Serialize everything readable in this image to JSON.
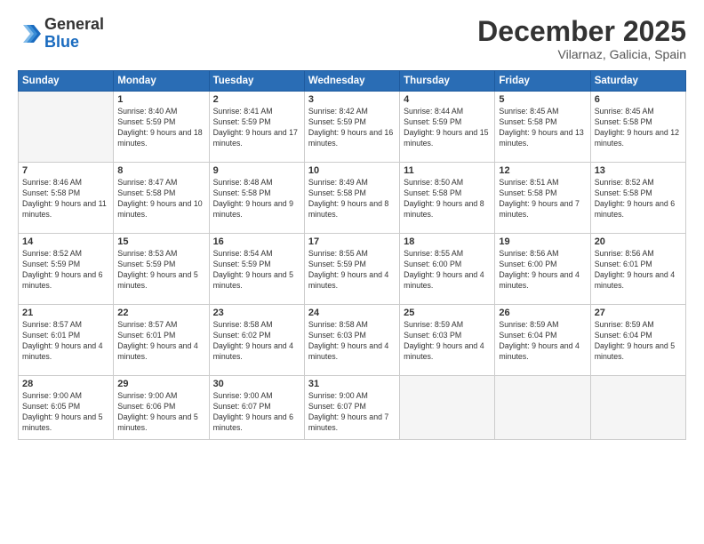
{
  "logo": {
    "general": "General",
    "blue": "Blue"
  },
  "header": {
    "title": "December 2025",
    "subtitle": "Vilarnaz, Galicia, Spain"
  },
  "weekdays": [
    "Sunday",
    "Monday",
    "Tuesday",
    "Wednesday",
    "Thursday",
    "Friday",
    "Saturday"
  ],
  "weeks": [
    [
      {
        "day": "",
        "empty": true
      },
      {
        "day": "1",
        "sunrise": "Sunrise: 8:40 AM",
        "sunset": "Sunset: 5:59 PM",
        "daylight": "Daylight: 9 hours and 18 minutes."
      },
      {
        "day": "2",
        "sunrise": "Sunrise: 8:41 AM",
        "sunset": "Sunset: 5:59 PM",
        "daylight": "Daylight: 9 hours and 17 minutes."
      },
      {
        "day": "3",
        "sunrise": "Sunrise: 8:42 AM",
        "sunset": "Sunset: 5:59 PM",
        "daylight": "Daylight: 9 hours and 16 minutes."
      },
      {
        "day": "4",
        "sunrise": "Sunrise: 8:44 AM",
        "sunset": "Sunset: 5:59 PM",
        "daylight": "Daylight: 9 hours and 15 minutes."
      },
      {
        "day": "5",
        "sunrise": "Sunrise: 8:45 AM",
        "sunset": "Sunset: 5:58 PM",
        "daylight": "Daylight: 9 hours and 13 minutes."
      },
      {
        "day": "6",
        "sunrise": "Sunrise: 8:45 AM",
        "sunset": "Sunset: 5:58 PM",
        "daylight": "Daylight: 9 hours and 12 minutes."
      }
    ],
    [
      {
        "day": "7",
        "sunrise": "Sunrise: 8:46 AM",
        "sunset": "Sunset: 5:58 PM",
        "daylight": "Daylight: 9 hours and 11 minutes."
      },
      {
        "day": "8",
        "sunrise": "Sunrise: 8:47 AM",
        "sunset": "Sunset: 5:58 PM",
        "daylight": "Daylight: 9 hours and 10 minutes."
      },
      {
        "day": "9",
        "sunrise": "Sunrise: 8:48 AM",
        "sunset": "Sunset: 5:58 PM",
        "daylight": "Daylight: 9 hours and 9 minutes."
      },
      {
        "day": "10",
        "sunrise": "Sunrise: 8:49 AM",
        "sunset": "Sunset: 5:58 PM",
        "daylight": "Daylight: 9 hours and 8 minutes."
      },
      {
        "day": "11",
        "sunrise": "Sunrise: 8:50 AM",
        "sunset": "Sunset: 5:58 PM",
        "daylight": "Daylight: 9 hours and 8 minutes."
      },
      {
        "day": "12",
        "sunrise": "Sunrise: 8:51 AM",
        "sunset": "Sunset: 5:58 PM",
        "daylight": "Daylight: 9 hours and 7 minutes."
      },
      {
        "day": "13",
        "sunrise": "Sunrise: 8:52 AM",
        "sunset": "Sunset: 5:58 PM",
        "daylight": "Daylight: 9 hours and 6 minutes."
      }
    ],
    [
      {
        "day": "14",
        "sunrise": "Sunrise: 8:52 AM",
        "sunset": "Sunset: 5:59 PM",
        "daylight": "Daylight: 9 hours and 6 minutes."
      },
      {
        "day": "15",
        "sunrise": "Sunrise: 8:53 AM",
        "sunset": "Sunset: 5:59 PM",
        "daylight": "Daylight: 9 hours and 5 minutes."
      },
      {
        "day": "16",
        "sunrise": "Sunrise: 8:54 AM",
        "sunset": "Sunset: 5:59 PM",
        "daylight": "Daylight: 9 hours and 5 minutes."
      },
      {
        "day": "17",
        "sunrise": "Sunrise: 8:55 AM",
        "sunset": "Sunset: 5:59 PM",
        "daylight": "Daylight: 9 hours and 4 minutes."
      },
      {
        "day": "18",
        "sunrise": "Sunrise: 8:55 AM",
        "sunset": "Sunset: 6:00 PM",
        "daylight": "Daylight: 9 hours and 4 minutes."
      },
      {
        "day": "19",
        "sunrise": "Sunrise: 8:56 AM",
        "sunset": "Sunset: 6:00 PM",
        "daylight": "Daylight: 9 hours and 4 minutes."
      },
      {
        "day": "20",
        "sunrise": "Sunrise: 8:56 AM",
        "sunset": "Sunset: 6:01 PM",
        "daylight": "Daylight: 9 hours and 4 minutes."
      }
    ],
    [
      {
        "day": "21",
        "sunrise": "Sunrise: 8:57 AM",
        "sunset": "Sunset: 6:01 PM",
        "daylight": "Daylight: 9 hours and 4 minutes."
      },
      {
        "day": "22",
        "sunrise": "Sunrise: 8:57 AM",
        "sunset": "Sunset: 6:01 PM",
        "daylight": "Daylight: 9 hours and 4 minutes."
      },
      {
        "day": "23",
        "sunrise": "Sunrise: 8:58 AM",
        "sunset": "Sunset: 6:02 PM",
        "daylight": "Daylight: 9 hours and 4 minutes."
      },
      {
        "day": "24",
        "sunrise": "Sunrise: 8:58 AM",
        "sunset": "Sunset: 6:03 PM",
        "daylight": "Daylight: 9 hours and 4 minutes."
      },
      {
        "day": "25",
        "sunrise": "Sunrise: 8:59 AM",
        "sunset": "Sunset: 6:03 PM",
        "daylight": "Daylight: 9 hours and 4 minutes."
      },
      {
        "day": "26",
        "sunrise": "Sunrise: 8:59 AM",
        "sunset": "Sunset: 6:04 PM",
        "daylight": "Daylight: 9 hours and 4 minutes."
      },
      {
        "day": "27",
        "sunrise": "Sunrise: 8:59 AM",
        "sunset": "Sunset: 6:04 PM",
        "daylight": "Daylight: 9 hours and 5 minutes."
      }
    ],
    [
      {
        "day": "28",
        "sunrise": "Sunrise: 9:00 AM",
        "sunset": "Sunset: 6:05 PM",
        "daylight": "Daylight: 9 hours and 5 minutes."
      },
      {
        "day": "29",
        "sunrise": "Sunrise: 9:00 AM",
        "sunset": "Sunset: 6:06 PM",
        "daylight": "Daylight: 9 hours and 5 minutes."
      },
      {
        "day": "30",
        "sunrise": "Sunrise: 9:00 AM",
        "sunset": "Sunset: 6:07 PM",
        "daylight": "Daylight: 9 hours and 6 minutes."
      },
      {
        "day": "31",
        "sunrise": "Sunrise: 9:00 AM",
        "sunset": "Sunset: 6:07 PM",
        "daylight": "Daylight: 9 hours and 7 minutes."
      },
      {
        "day": "",
        "empty": true
      },
      {
        "day": "",
        "empty": true
      },
      {
        "day": "",
        "empty": true
      }
    ]
  ]
}
